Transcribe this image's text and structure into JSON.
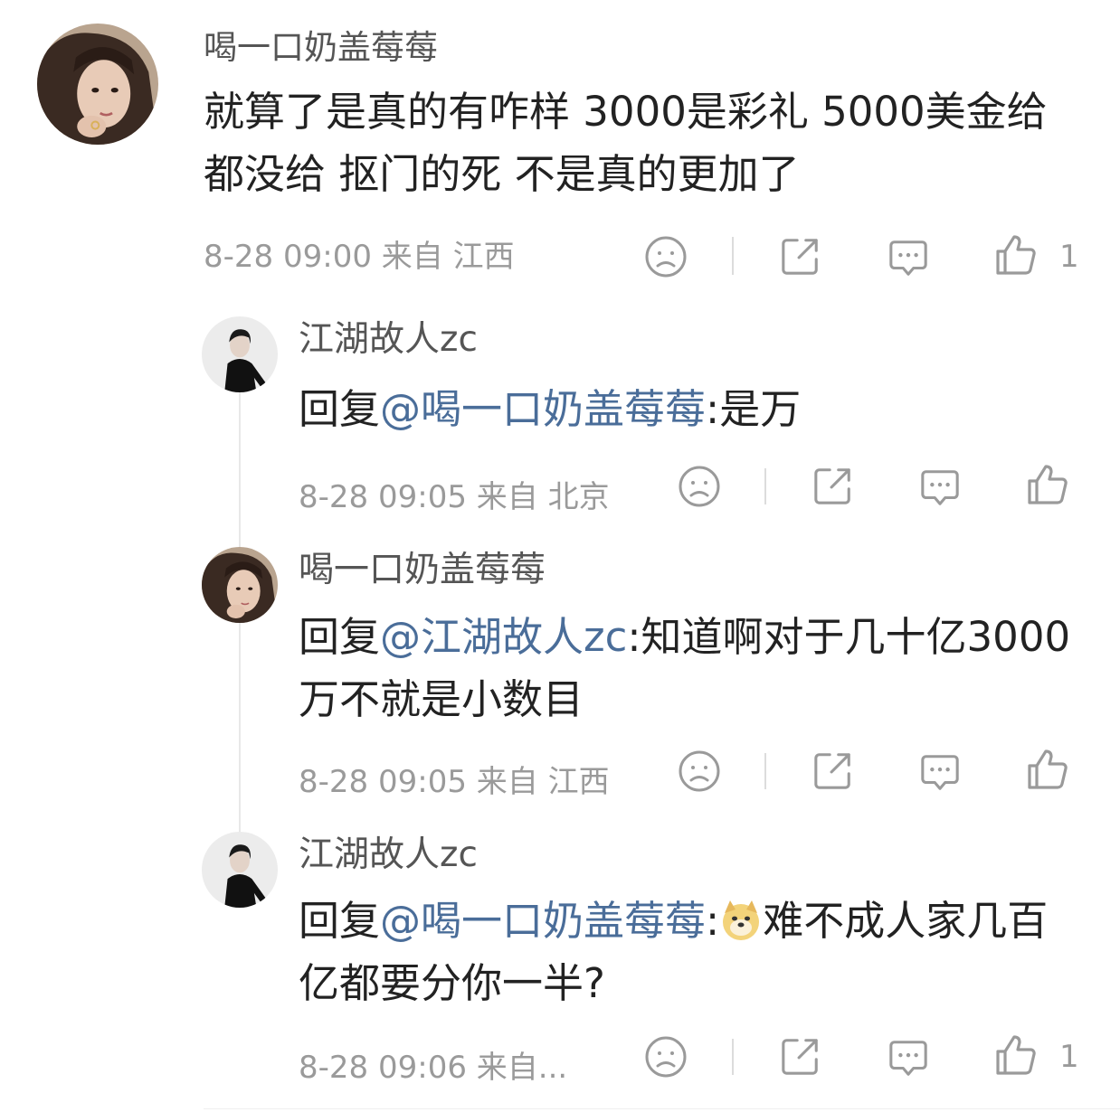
{
  "comment": {
    "author": "喝一口奶盖莓莓",
    "text": "就算了是真的有咋样 3000是彩礼 5000美金给都没给 抠门的死 不是真的更加了",
    "meta": "8-28 09:00  来自 江西",
    "like_count": "1"
  },
  "replies": [
    {
      "author": "江湖故人zc",
      "prefix": "回复",
      "mention": "@喝一口奶盖莓莓",
      "text": ":是万",
      "meta": "8-28 09:05  来自 北京"
    },
    {
      "author": "喝一口奶盖莓莓",
      "prefix": "回复",
      "mention": "@江湖故人zc",
      "text": ":知道啊对于几十亿3000万不就是小数目",
      "meta": "8-28 09:05  来自 江西"
    },
    {
      "author": "江湖故人zc",
      "prefix": "回复",
      "mention": "@喝一口奶盖莓莓",
      "text": ":",
      "emoji": "doge-emoji",
      "text2": "难不成人家几百亿都要分你一半?",
      "meta": "8-28 09:06  来自...",
      "like_count": "1"
    }
  ],
  "icons": {
    "dislike": "sad-face-icon",
    "share": "share-icon",
    "comment": "comment-icon",
    "like": "thumbs-up-icon"
  },
  "colors": {
    "mention": "#4a6d99",
    "meta": "#9a9a9a",
    "icon": "#9a9a9a"
  }
}
